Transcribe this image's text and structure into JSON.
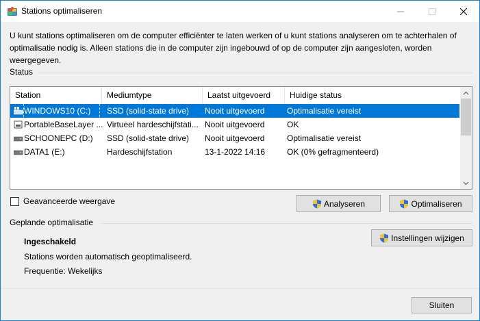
{
  "window": {
    "title": "Stations optimaliseren",
    "minimize_label": "Minimaliseren",
    "maximize_label": "Maximaliseren",
    "close_label": "Sluiten"
  },
  "intro_text": "U kunt stations optimaliseren om de computer efficiënter te laten werken of u kunt stations analyseren om te achterhalen of optimalisatie nodig is. Alleen stations die in de computer zijn ingebouwd of op de computer zijn aangesloten, worden weergegeven.",
  "status": {
    "label": "Status",
    "columns": [
      "Station",
      "Mediumtype",
      "Laatst uitgevoerd",
      "Huidige status"
    ],
    "rows": [
      {
        "icon": "windows-drive-icon",
        "station": "WINDOWS10 (C:)",
        "media": "SSD (solid-state drive)",
        "last_run": "Nooit uitgevoerd",
        "status": "Optimalisatie vereist",
        "selected": true
      },
      {
        "icon": "virtual-drive-icon",
        "station": "PortableBaseLayer ...",
        "media": "Virtueel hardeschijfstati...",
        "last_run": "Nooit uitgevoerd",
        "status": "OK",
        "selected": false
      },
      {
        "icon": "drive-icon",
        "station": "SCHOONEPC (D:)",
        "media": "SSD (solid-state drive)",
        "last_run": "Nooit uitgevoerd",
        "status": "Optimalisatie vereist",
        "selected": false
      },
      {
        "icon": "drive-icon",
        "station": "DATA1 (E:)",
        "media": "Hardeschijfstation",
        "last_run": "13-1-2022 14:16",
        "status": "OK (0% gefragmenteerd)",
        "selected": false
      }
    ],
    "advanced_view_label": "Geavanceerde weergave",
    "advanced_view_checked": false,
    "analyze_label": "Analyseren",
    "optimize_label": "Optimaliseren"
  },
  "scheduled": {
    "label": "Geplande optimalisatie",
    "state": "Ingeschakeld",
    "description": "Stations worden automatisch geoptimaliseerd.",
    "frequency": "Frequentie: Wekelijks",
    "change_settings_label": "Instellingen wijzigen"
  },
  "close_button_label": "Sluiten"
}
